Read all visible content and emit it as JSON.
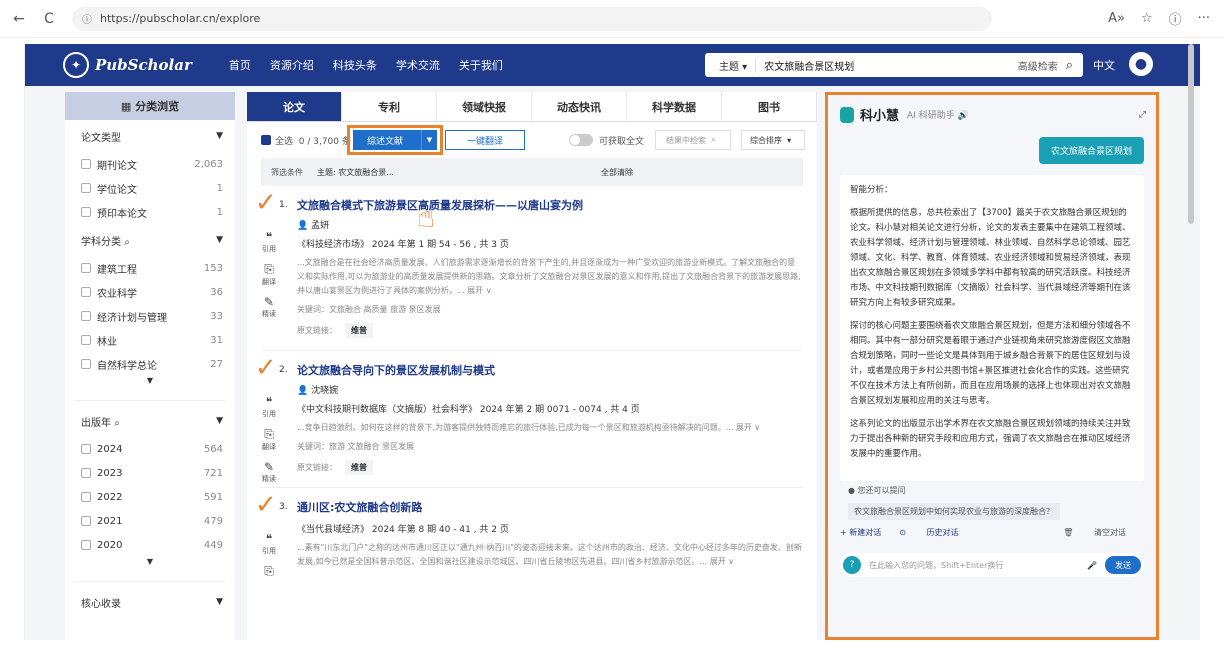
{
  "browser": {
    "url": "https://pubscholar.cn/explore",
    "back": "←",
    "reload": "C",
    "lock": "ⓘ",
    "icons": [
      "A»",
      "☆",
      "ⓘ",
      "···"
    ]
  },
  "nav": {
    "logo": "PubScholar",
    "menu": [
      "首页",
      "资源介绍",
      "科技头条",
      "学术交流",
      "关于我们"
    ],
    "search_field": "主题",
    "query": "农文旅融合景区规划",
    "advanced": "高级检索",
    "lang": "中文"
  },
  "sidebar": {
    "header": "分类浏览",
    "groups": [
      {
        "title": "论文类型",
        "items": [
          {
            "label": "期刊论文",
            "count": "2,063"
          },
          {
            "label": "学位论文",
            "count": "1"
          },
          {
            "label": "预印本论文",
            "count": "1"
          }
        ]
      },
      {
        "title": "学科分类",
        "items": [
          {
            "label": "建筑工程",
            "count": "153"
          },
          {
            "label": "农业科学",
            "count": "36"
          },
          {
            "label": "经济计划与管理",
            "count": "33"
          },
          {
            "label": "林业",
            "count": "31"
          },
          {
            "label": "自然科学总论",
            "count": "27"
          }
        ]
      },
      {
        "title": "出版年",
        "items": [
          {
            "label": "2024",
            "count": "564"
          },
          {
            "label": "2023",
            "count": "721"
          },
          {
            "label": "2022",
            "count": "591"
          },
          {
            "label": "2021",
            "count": "479"
          },
          {
            "label": "2020",
            "count": "449"
          }
        ]
      },
      {
        "title": "核心收录"
      }
    ]
  },
  "tabs": [
    "论文",
    "专利",
    "领域快报",
    "动态快讯",
    "科学数据",
    "图书"
  ],
  "toolbar": {
    "select_all": "全选",
    "count": "0 / 3,700 条",
    "review_btn": "综述文献",
    "translate_btn": "一键翻译",
    "fulltext": "可获取全文",
    "result_search": "结果中检索",
    "sort": "综合排序"
  },
  "filter": {
    "label": "筛选条件",
    "chip": "主题: 农文旅融合景...",
    "clear": "全部清除"
  },
  "side_actions": {
    "cite": "引用",
    "translate": "翻译",
    "read": "精读"
  },
  "results": [
    {
      "num": "1.",
      "title": "文旅融合模式下旅游景区高质量发展探析——以唐山宴为例",
      "author": "孟妍",
      "source": "《科技经济市场》 2024 年第 1 期 54 - 56 , 共 3 页",
      "abstract": "...文旅融合是在社会经济高质量发展、人们旅游需求逐渐增长的背景下产生的,并且逐渐成为一种广受欢迎的旅游业新模式。了解文旅融合的意义和实际作用,可以为旅游业的高质量发展提供新的思路。文章分析了文旅融合对景区发展的意义和作用,提出了文旅融合背景下的旅游发展思路,并以唐山宴景区为例进行了具体的案例分析。... 展开 ∨",
      "keywords": "关键词：文旅融合  高质量  旅游  景区发展",
      "link_label": "原文链接：",
      "link": "维普"
    },
    {
      "num": "2.",
      "title": "论文旅融合导向下的景区发展机制与模式",
      "author": "沈晓婉",
      "source": "《中文科技期刊数据库（文摘版）社会科学》 2024 年第 2 期 0071 - 0074 , 共 4 页",
      "abstract": "...竞争日趋激烈。如何在这样的背景下,为游客提供独特而难忘的旅行体验,已成为每一个景区和旅游机构亟待解决的问题。... 展开 ∨",
      "keywords": "关键词：旅游  文旅融合  景区发展",
      "link_label": "原文链接：",
      "link": "维普"
    },
    {
      "num": "3.",
      "title": "通川区:农文旅融合创新路",
      "source": "《当代县域经济》 2024 年第 8 期 40 - 41 , 共 2 页",
      "abstract": "...素有\"川东北门户\"之称的达州市通川区正以\"通九州·纳百川\"的姿态迎接未来。这个达州市的政治、经济、文化中心经过多年的历史奋发、创新发展,如今已然是全国科普示范区、全国和谐社区建设示范城区、四川省丘陵地区先进县、四川省乡村旅游示范区。... 展开 ∨"
    }
  ],
  "ai": {
    "name": "科小慧",
    "subtitle": "AI 科研助手 🔊",
    "user_msg": "农文旅融合景区规划",
    "paragraphs": [
      "智能分析：",
      "根据所提供的信息，总共检索出了【3700】篇关于农文旅融合景区规划的论文。科小慧对相关论文进行分析，论文的发表主要集中在建筑工程领域、农业科学领域、经济计划与管理领域、林业领域、自然科学总论领域、园艺领域、文化、科学、教育、体育领域、农业经济领域和贸易经济领域，表现出农文旅融合景区规划在多领域多学科中都有较高的研究活跃度。科技经济市场、中文科技期刊数据库（文摘版）社会科学、当代县域经济等期刊在该研究方向上有较多研究成果。",
      "探讨的核心问题主要围绕着农文旅融合景区规划，但是方法和细分领域各不相同。其中有一部分研究是着眼于通过产业链视角来研究旅游度假区文旅融合规划策略，同时一些论文是具体到用于城乡融合背景下的居住区规划与设计，或者是应用于乡村公共图书馆+景区推进社会化合作的实践。这些研究不仅在技术方法上有所创新，而且在应用场景的选择上也体现出对农文旅融合景区规划发展和应用的关注与思考。",
      "这系列论文的出版显示出学术界在农文旅融合景区规划领域的持续关注并致力于提出各种新的研究手段和应用方式，强调了农文旅融合在推动区域经济发展中的重要作用。"
    ],
    "ask_label": "您还可以提问",
    "suggestion": "农文旅融合景区规划中如何实现农业与旅游的深度融合？",
    "new_chat": "+ 新建对话",
    "history": "历史对话",
    "clear": "清空对话",
    "input_placeholder": "在此输入您的问题，Shift+Enter换行",
    "send": "发送"
  }
}
